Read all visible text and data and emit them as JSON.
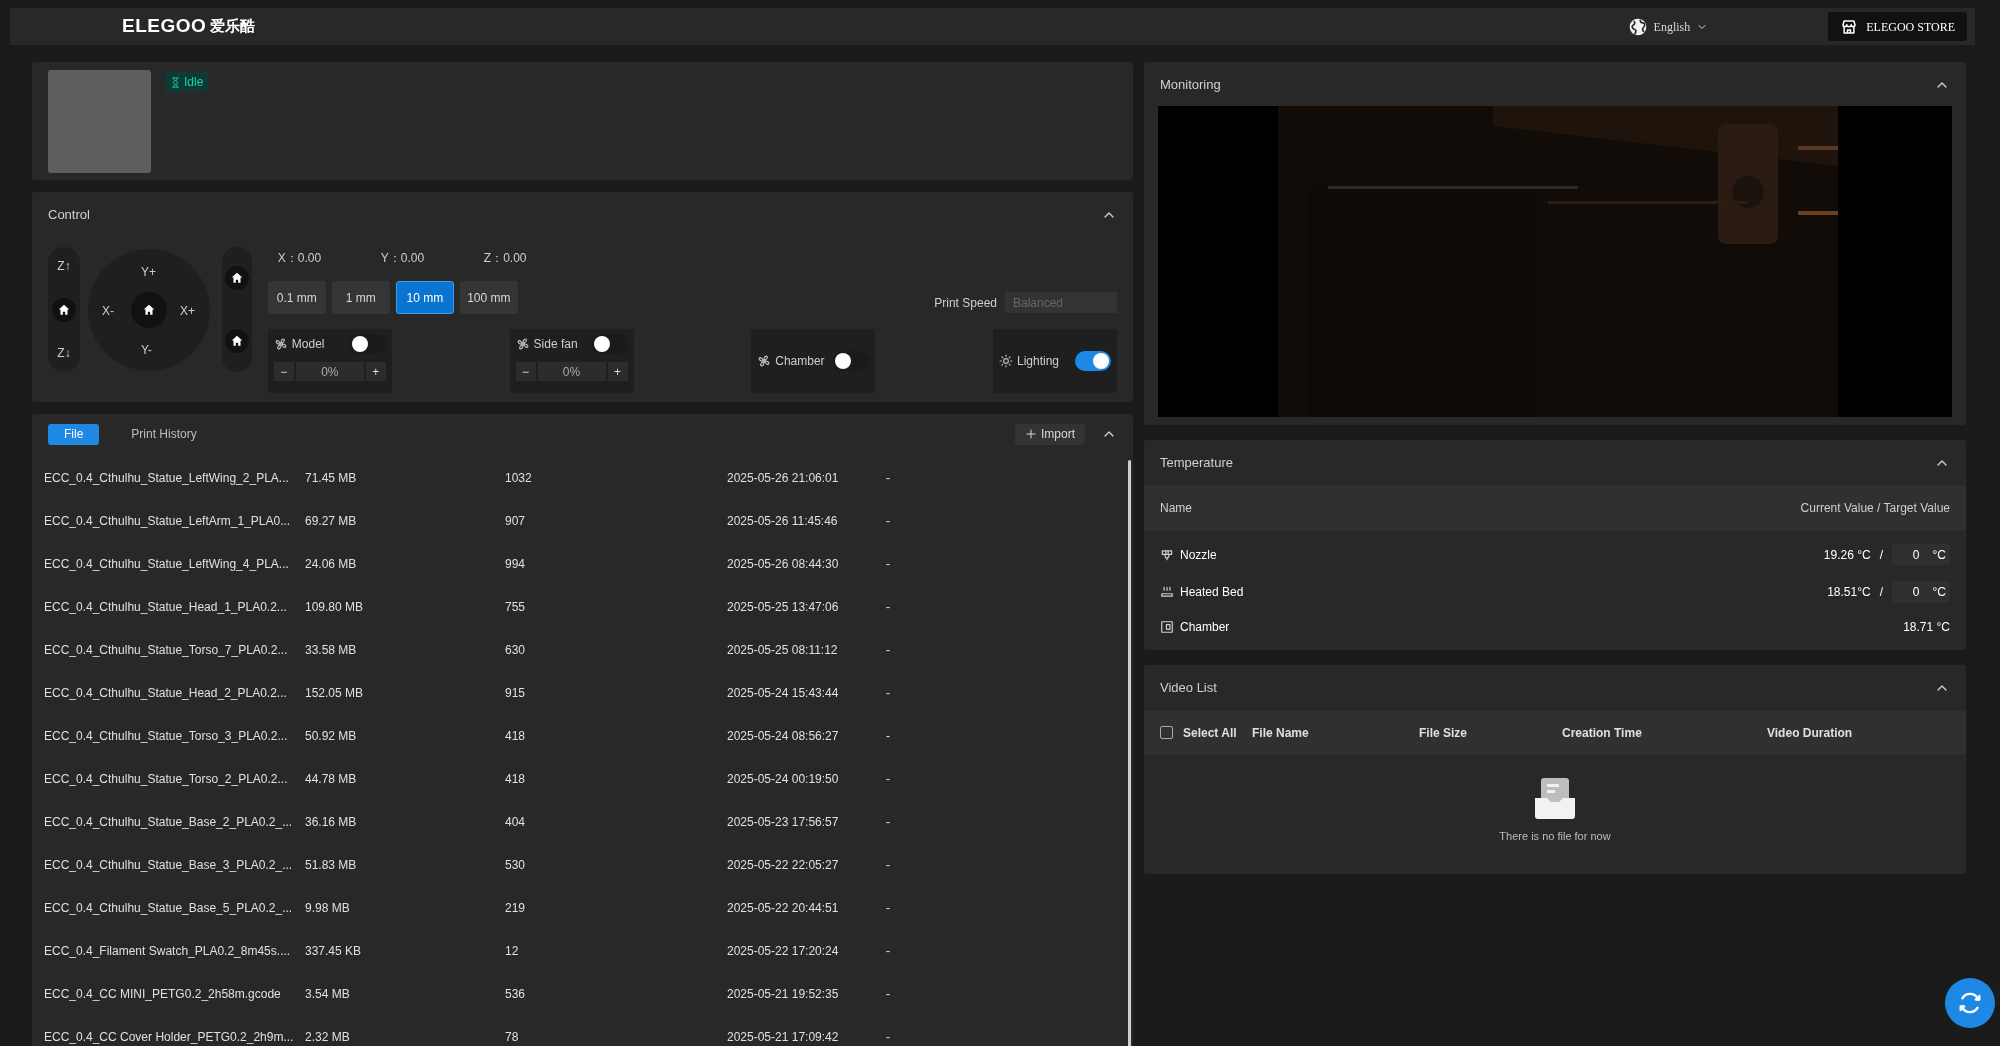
{
  "header": {
    "logo": "ELEGOO",
    "logo_cn": "爱乐酷",
    "language": "English",
    "store_button": "ELEGOO STORE"
  },
  "printer": {
    "status": "Idle"
  },
  "control": {
    "title": "Control",
    "jog": {
      "z_up": "Z↑",
      "z_down": "Z↓",
      "y_plus": "Y+",
      "y_minus": "Y-",
      "x_minus": "X-",
      "x_plus": "X+"
    },
    "positions": [
      {
        "axis": "X：",
        "value": "0.00"
      },
      {
        "axis": "Y：",
        "value": "0.00"
      },
      {
        "axis": "Z：",
        "value": "0.00"
      }
    ],
    "steps": [
      {
        "label": "0.1 mm",
        "selected": false
      },
      {
        "label": "1 mm",
        "selected": false
      },
      {
        "label": "10 mm",
        "selected": true
      },
      {
        "label": "100 mm",
        "selected": false
      }
    ],
    "print_speed": {
      "label": "Print Speed",
      "placeholder": "Balanced"
    },
    "switches": [
      {
        "kind": "fan_stepper",
        "label": "Model",
        "on": false,
        "value": "0%",
        "minus": "−",
        "plus": "+"
      },
      {
        "kind": "fan_stepper",
        "label": "Side fan",
        "on": false,
        "value": "0%",
        "minus": "−",
        "plus": "+"
      },
      {
        "kind": "fan",
        "label": "Chamber",
        "on": false
      },
      {
        "kind": "light",
        "label": "Lighting",
        "on": true
      }
    ]
  },
  "files": {
    "tabs": [
      {
        "label": "File",
        "selected": true
      },
      {
        "label": "Print History",
        "selected": false
      }
    ],
    "import_button": "Import",
    "rows": [
      {
        "name": "ECC_0.4_Cthulhu_Statue_LeftWing_2_PLA...",
        "size": "71.45 MB",
        "column_3": "1032",
        "time": "2025-05-26 21:06:01",
        "column_5": "-"
      },
      {
        "name": "ECC_0.4_Cthulhu_Statue_LeftArm_1_PLA0...",
        "size": "69.27 MB",
        "column_3": "907",
        "time": "2025-05-26 11:45:46",
        "column_5": "-"
      },
      {
        "name": "ECC_0.4_Cthulhu_Statue_LeftWing_4_PLA...",
        "size": "24.06 MB",
        "column_3": "994",
        "time": "2025-05-26 08:44:30",
        "column_5": "-"
      },
      {
        "name": "ECC_0.4_Cthulhu_Statue_Head_1_PLA0.2...",
        "size": "109.80 MB",
        "column_3": "755",
        "time": "2025-05-25 13:47:06",
        "column_5": "-"
      },
      {
        "name": "ECC_0.4_Cthulhu_Statue_Torso_7_PLA0.2...",
        "size": "33.58 MB",
        "column_3": "630",
        "time": "2025-05-25 08:11:12",
        "column_5": "-"
      },
      {
        "name": "ECC_0.4_Cthulhu_Statue_Head_2_PLA0.2...",
        "size": "152.05 MB",
        "column_3": "915",
        "time": "2025-05-24 15:43:44",
        "column_5": "-"
      },
      {
        "name": "ECC_0.4_Cthulhu_Statue_Torso_3_PLA0.2...",
        "size": "50.92 MB",
        "column_3": "418",
        "time": "2025-05-24 08:56:27",
        "column_5": "-"
      },
      {
        "name": "ECC_0.4_Cthulhu_Statue_Torso_2_PLA0.2...",
        "size": "44.78 MB",
        "column_3": "418",
        "time": "2025-05-24 00:19:50",
        "column_5": "-"
      },
      {
        "name": "ECC_0.4_Cthulhu_Statue_Base_2_PLA0.2_...",
        "size": "36.16 MB",
        "column_3": "404",
        "time": "2025-05-23 17:56:57",
        "column_5": "-"
      },
      {
        "name": "ECC_0.4_Cthulhu_Statue_Base_3_PLA0.2_...",
        "size": "51.83 MB",
        "column_3": "530",
        "time": "2025-05-22 22:05:27",
        "column_5": "-"
      },
      {
        "name": "ECC_0.4_Cthulhu_Statue_Base_5_PLA0.2_...",
        "size": "9.98 MB",
        "column_3": "219",
        "time": "2025-05-22 20:44:51",
        "column_5": "-"
      },
      {
        "name": "ECC_0.4_Filament Swatch_PLA0.2_8m45s....",
        "size": "337.45 KB",
        "column_3": "12",
        "time": "2025-05-22 17:20:24",
        "column_5": "-"
      },
      {
        "name": "ECC_0.4_CC MINI_PETG0.2_2h58m.gcode",
        "size": "3.54 MB",
        "column_3": "536",
        "time": "2025-05-21 19:52:35",
        "column_5": "-"
      },
      {
        "name": "ECC_0.4_CC Cover Holder_PETG0.2_2h9m...",
        "size": "2.32 MB",
        "column_3": "78",
        "time": "2025-05-21 17:09:42",
        "column_5": "-"
      }
    ]
  },
  "monitoring": {
    "title": "Monitoring"
  },
  "temperature": {
    "title": "Temperature",
    "columns": [
      "Name",
      "Current Value / Target Value"
    ],
    "rows": [
      {
        "kind": "nozzle",
        "name": "Nozzle",
        "current": "19.26 °C",
        "separator": "/",
        "target": "0",
        "unit": "°C"
      },
      {
        "kind": "bed",
        "name": "Heated Bed",
        "current": "18.51°C",
        "separator": "/",
        "target": "0",
        "unit": "°C"
      },
      {
        "kind": "chamber",
        "name": "Chamber",
        "reading": "18.71 °C"
      }
    ]
  },
  "video_list": {
    "title": "Video List",
    "select_all": {
      "label": "Select All",
      "checked": false
    },
    "columns": [
      "File Name",
      "File Size",
      "Creation Time",
      "Video Duration"
    ],
    "empty_text": "There is no file for now"
  }
}
